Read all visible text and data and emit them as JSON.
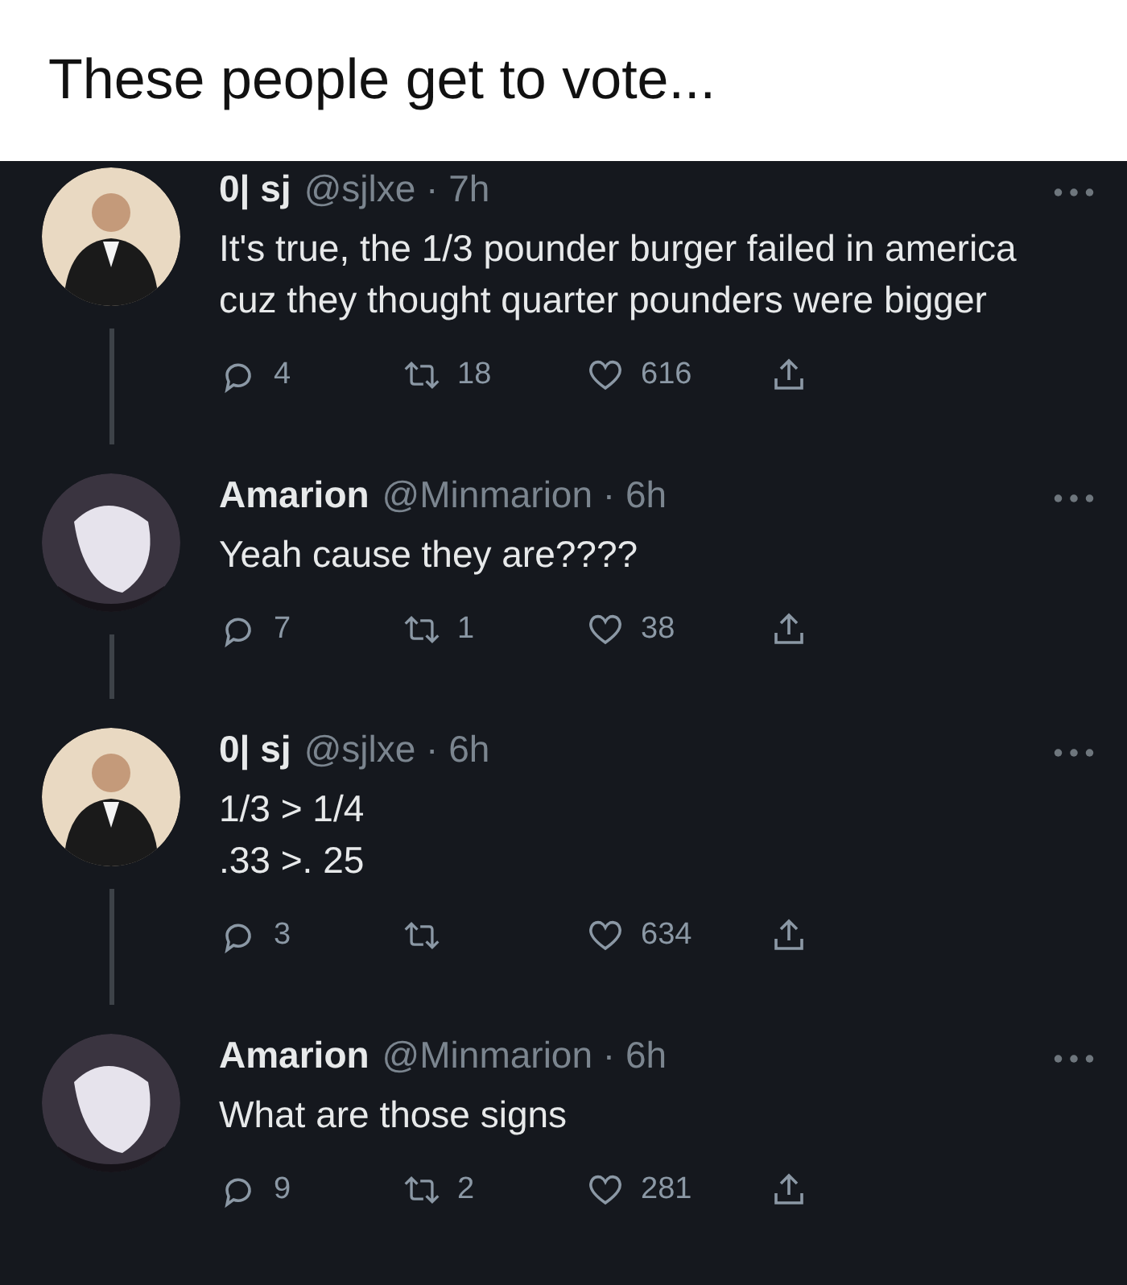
{
  "caption": "These people get to vote...",
  "tweets": [
    {
      "avatar": {
        "kind": "person"
      },
      "name": "0| sj",
      "handle": "@sjlxe · 7h",
      "text": "It's true, the 1/3 pounder burger failed in america cuz they thought quarter pounders were bigger",
      "thread_line": true,
      "replies": "4",
      "retweets": "18",
      "likes": "616"
    },
    {
      "avatar": {
        "kind": "cartoon"
      },
      "name": "Amarion",
      "handle": "@Minmarion · 6h",
      "text": "Yeah cause they are????",
      "thread_line": true,
      "replies": "7",
      "retweets": "1",
      "likes": "38"
    },
    {
      "avatar": {
        "kind": "person"
      },
      "name": "0| sj",
      "handle": "@sjlxe · 6h",
      "text": "1/3 > 1/4\n.33 >. 25",
      "thread_line": true,
      "replies": "3",
      "likes": "634"
    },
    {
      "avatar": {
        "kind": "cartoon"
      },
      "name": "Amarion",
      "handle": "@Minmarion · 6h",
      "text": "What are those signs",
      "thread_line": false,
      "replies": "9",
      "retweets": "2",
      "likes": "281"
    }
  ]
}
